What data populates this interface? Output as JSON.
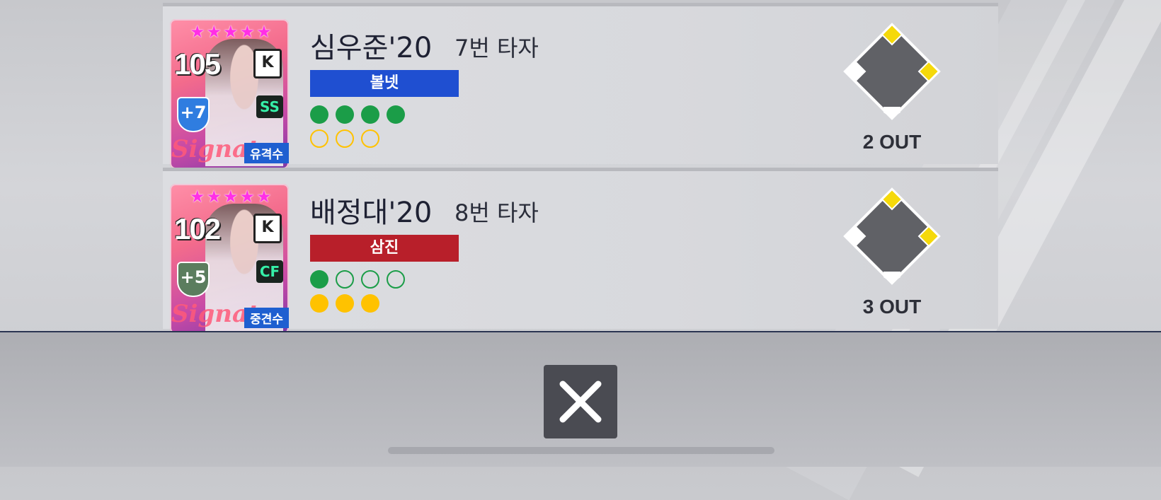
{
  "rows": [
    {
      "name": "심우준'20",
      "order": "7번 타자",
      "ovr": "105",
      "stars": "★★★★★",
      "boost": "+7",
      "position": "SS",
      "position_name": "유격수",
      "signature": "Signature",
      "result": "볼넷",
      "result_color": "#1f4fd1",
      "balls_shown": 4,
      "strikes_shown": 0,
      "outs": "2 OUT",
      "bases": {
        "first": true,
        "second": true,
        "third": false
      }
    },
    {
      "name": "배정대'20",
      "order": "8번 타자",
      "ovr": "102",
      "stars": "★★★★★",
      "boost": "+5",
      "position": "CF",
      "position_name": "중견수",
      "signature": "Signature",
      "result": "삼진",
      "result_color": "#b81f2a",
      "balls_shown": 1,
      "strikes_shown": 3,
      "outs": "3 OUT",
      "bases": {
        "first": true,
        "second": true,
        "third": false
      }
    }
  ],
  "colors": {
    "base_on": "#f5d90a",
    "base_off": "#ffffff",
    "field": "#606166"
  },
  "icons": {
    "close": "close-x-icon"
  }
}
